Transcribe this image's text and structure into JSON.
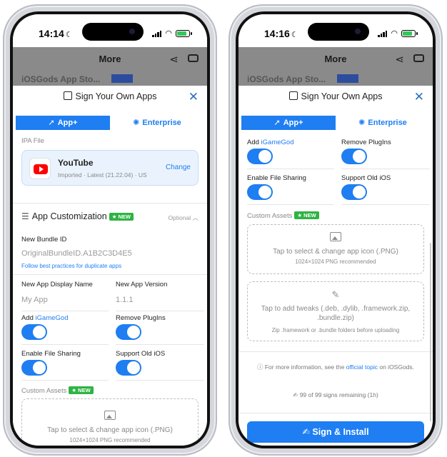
{
  "status": {
    "left_time": "14:14",
    "right_time": "14:16"
  },
  "navbar": {
    "title": "More",
    "behind_text": "iOSGods App Sto..."
  },
  "sheet": {
    "title": "Sign Your Own Apps"
  },
  "tabs": {
    "app_plus": "App+",
    "enterprise": "Enterprise"
  },
  "left": {
    "ipa_label": "IPA File",
    "app_name": "YouTube",
    "app_meta": "Imported · Latest (21.22.04) · US",
    "change": "Change",
    "customization_title": "App Customization",
    "new_badge": "NEW",
    "optional": "Optional",
    "bundle_label": "New Bundle ID",
    "bundle_placeholder": "OriginalBundleID.A1B2C3D4E5",
    "bundle_hint": "Follow best practices for duplicate apps",
    "display_name_label": "New App Display Name",
    "display_name_placeholder": "My App",
    "version_label": "New App Version",
    "version_placeholder": "1.1.1",
    "add_label": "Add",
    "add_link": "iGameGod",
    "remove_plugins": "Remove PlugIns",
    "file_sharing": "Enable File Sharing",
    "old_ios": "Support Old iOS",
    "custom_assets": "Custom Assets",
    "icon_text": "Tap to select & change app icon (.PNG)",
    "icon_sub": "1024×1024 PNG recommended"
  },
  "right": {
    "add_label": "Add",
    "add_link": "iGameGod",
    "remove_plugins": "Remove PlugIns",
    "file_sharing": "Enable File Sharing",
    "old_ios": "Support Old iOS",
    "custom_assets": "Custom Assets",
    "new_badge": "NEW",
    "icon_text": "Tap to select & change app icon (.PNG)",
    "icon_sub": "1024×1024 PNG recommended",
    "tweak_text_1": "Tap to add tweaks (.deb, .dylib, .framework.zip,",
    "tweak_text_2": ".bundle.zip)",
    "tweak_sub": "Zip .framework or .bundle folders before uploading",
    "info_pre": "For more information, see the",
    "info_link": "official topic",
    "info_post": "on iOSGods.",
    "signs": "99 of 99 signs remaining (1h)",
    "install": "Sign & Install"
  },
  "colors": {
    "accent": "#1e7ef2",
    "badge": "#2fb344",
    "overlay": "#8a8a8a"
  }
}
